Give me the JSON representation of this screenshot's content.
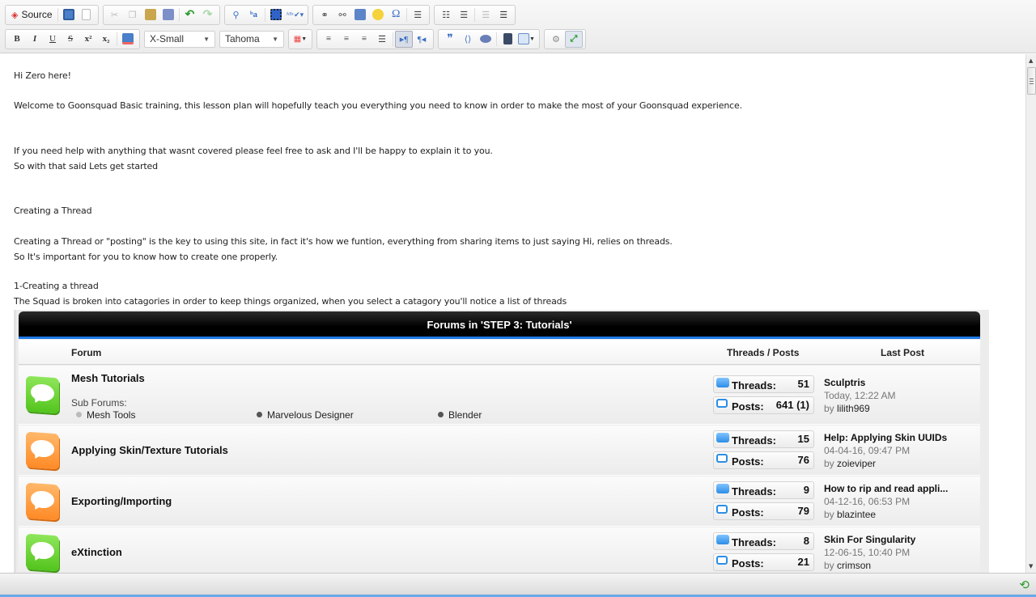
{
  "toolbar": {
    "source_label": "Source",
    "font_size": "X-Small",
    "font_family": "Tahoma",
    "row1_icons": [
      "save-icon",
      "new-page-icon",
      "cut-icon",
      "copy-icon",
      "paste-icon",
      "paste-word-icon",
      "undo-icon",
      "redo-icon",
      "find-icon",
      "replace-icon",
      "select-all-icon",
      "spellcheck-icon",
      "link-icon",
      "unlink-icon",
      "image-icon",
      "smiley-icon",
      "special-char-icon",
      "horizontal-rule-icon",
      "numbered-list-icon",
      "bulleted-list-icon",
      "outdent-icon",
      "indent-icon"
    ],
    "row2_labels": {
      "bold": "B",
      "italic": "I",
      "underline": "U",
      "strike": "S",
      "superscript": "x²",
      "subscript": "x₂",
      "omega": "Ω",
      "quote": "❞"
    }
  },
  "editor": {
    "paragraphs": [
      "Hi Zero here!",
      "Welcome to Goonsquad Basic training, this lesson plan will hopefully teach you everything you need to know in order to make the most of your Goonsquad experience.",
      "If you need help with  anything that wasnt covered please feel free to ask and I'll be happy to explain it to you.",
      "So with that said Lets get started",
      "Creating a Thread",
      "Creating a Thread or \"posting\" is the key to using this site, in fact it's how we funtion, everything from sharing items to just saying Hi, relies on threads.",
      "So It's important for you to know how to create one properly.",
      "1-Creating a thread",
      "The Squad is broken into catagories in order to keep things organized, when you select a catagory you'll notice a list of threads"
    ]
  },
  "forum": {
    "title": "Forums in 'STEP 3: Tutorials'",
    "col_forum": "Forum",
    "col_threads_posts": "Threads / Posts",
    "col_last_post": "Last Post",
    "threads_label": "Threads:",
    "posts_label": "Posts:",
    "by_label": "by",
    "sub_forums_label": "Sub Forums:",
    "rows": [
      {
        "name": "Mesh Tutorials",
        "icon": "green",
        "threads": "51",
        "posts": "641 (1)",
        "last_title": "Sculptris",
        "last_date": "Today, 12:22 AM",
        "last_user": "lilith969",
        "subforums": [
          "Mesh Tools",
          "Marvelous Designer",
          "Blender"
        ]
      },
      {
        "name": "Applying Skin/Texture Tutorials",
        "icon": "orange",
        "threads": "15",
        "posts": "76",
        "last_title": "Help: Applying Skin UUIDs",
        "last_date": "04-04-16, 09:47 PM",
        "last_user": "zoieviper"
      },
      {
        "name": "Exporting/Importing",
        "icon": "orange",
        "threads": "9",
        "posts": "79",
        "last_title": "How to rip and read appli...",
        "last_date": "04-12-16, 06:53 PM",
        "last_user": "blazintee"
      },
      {
        "name": "eXtinction",
        "icon": "green",
        "threads": "8",
        "posts": "21",
        "last_title": "Skin For Singularity",
        "last_date": "12-06-15, 10:40 PM",
        "last_user": "crimson"
      }
    ]
  },
  "colors": {
    "accent_blue": "#1e78e6",
    "green_icon": "#53c41d",
    "orange_icon": "#ff8a26"
  }
}
